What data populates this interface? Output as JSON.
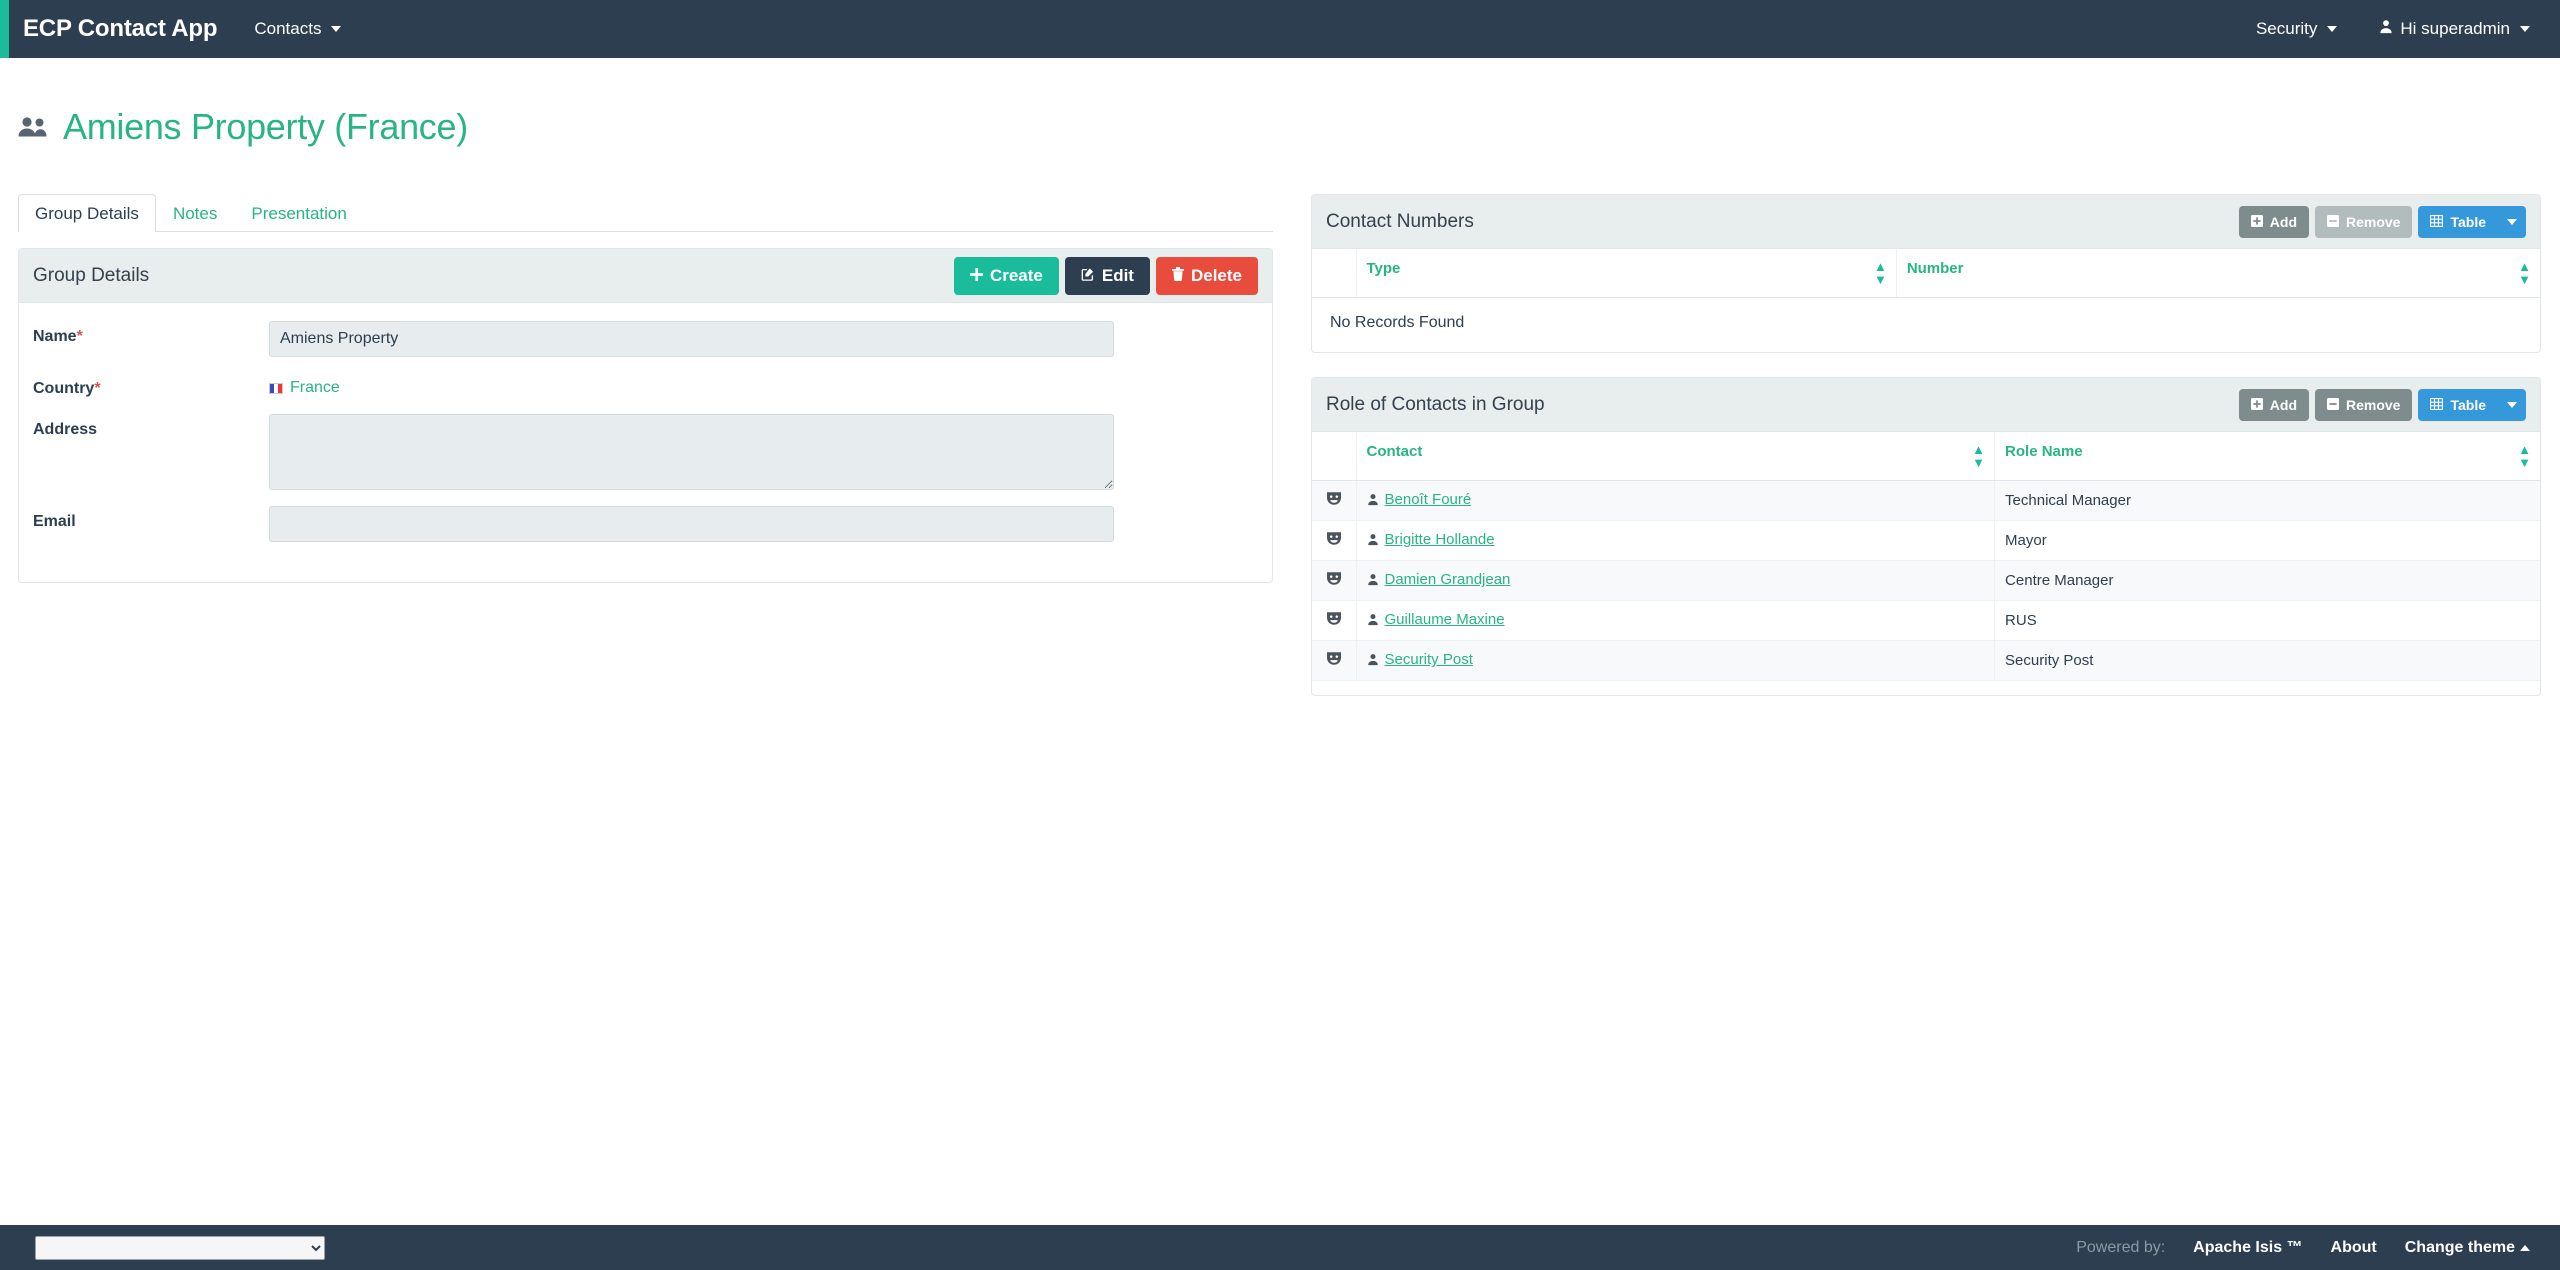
{
  "navbar": {
    "brand": "ECP Contact App",
    "left_items": [
      {
        "label": "Contacts",
        "icon": "chevron-down-icon"
      }
    ],
    "right_items": [
      {
        "label": "Security",
        "icon": "chevron-down-icon"
      },
      {
        "label": "Hi superadmin",
        "icon": "user-icon"
      }
    ],
    "accent_color": "#1abc9c",
    "background_color": "#2c3e50"
  },
  "page": {
    "title": "Amiens Property (France)",
    "title_icon": "group-people-icon",
    "title_color": "#28b485"
  },
  "tabs": [
    {
      "label": "Group Details",
      "active": true
    },
    {
      "label": "Notes",
      "active": false
    },
    {
      "label": "Presentation",
      "active": false
    }
  ],
  "group_details": {
    "panel_title": "Group Details",
    "buttons": {
      "create": {
        "label": "Create",
        "icon": "plus-icon",
        "color": "#1abc9c"
      },
      "edit": {
        "label": "Edit",
        "icon": "pencil-square-icon",
        "color": "#2c3e50"
      },
      "delete": {
        "label": "Delete",
        "icon": "trash-icon",
        "color": "#e74c3c"
      }
    },
    "fields": {
      "name": {
        "label": "Name",
        "required": true,
        "value": "Amiens Property",
        "placeholder": ""
      },
      "country": {
        "label": "Country",
        "required": true,
        "value": "France",
        "icon": "france-flag-icon"
      },
      "address": {
        "label": "Address",
        "required": false,
        "value": "",
        "placeholder": ""
      },
      "email": {
        "label": "Email",
        "required": false,
        "value": "",
        "placeholder": ""
      }
    }
  },
  "contact_numbers": {
    "panel_title": "Contact Numbers",
    "buttons": {
      "add": {
        "label": "Add",
        "icon": "plus-square-icon",
        "enabled": true
      },
      "remove": {
        "label": "Remove",
        "icon": "minus-square-icon",
        "enabled": false
      },
      "table": {
        "label": "Table",
        "icon": "table-grid-icon",
        "color": "#3498db"
      }
    },
    "columns": [
      "Type",
      "Number"
    ],
    "rows": [],
    "empty_message": "No Records Found"
  },
  "role_of_contacts": {
    "panel_title": "Role of Contacts in Group",
    "buttons": {
      "add": {
        "label": "Add",
        "icon": "plus-square-icon",
        "enabled": true
      },
      "remove": {
        "label": "Remove",
        "icon": "minus-square-icon",
        "enabled": true
      },
      "table": {
        "label": "Table",
        "icon": "table-grid-icon",
        "color": "#3498db"
      }
    },
    "columns": [
      "Contact",
      "Role Name"
    ],
    "rows": [
      {
        "row_icon": "theater-mask-icon",
        "contact_icon": "person-icon",
        "contact": "Benoît Fouré",
        "role_name": "Technical Manager"
      },
      {
        "row_icon": "theater-mask-icon",
        "contact_icon": "person-icon",
        "contact": "Brigitte Hollande",
        "role_name": "Mayor"
      },
      {
        "row_icon": "theater-mask-icon",
        "contact_icon": "person-icon",
        "contact": "Damien Grandjean",
        "role_name": "Centre Manager"
      },
      {
        "row_icon": "theater-mask-icon",
        "contact_icon": "person-icon",
        "contact": "Guillaume Maxine",
        "role_name": "RUS"
      },
      {
        "row_icon": "theater-mask-icon",
        "contact_icon": "person-icon",
        "contact": "Security Post",
        "role_name": "Security Post"
      }
    ]
  },
  "footer": {
    "select_value": "",
    "powered_by_label": "Powered by:",
    "links": [
      {
        "label": "Apache Isis ™"
      },
      {
        "label": "About"
      },
      {
        "label": "Change theme",
        "icon": "chevron-up-icon"
      }
    ]
  }
}
